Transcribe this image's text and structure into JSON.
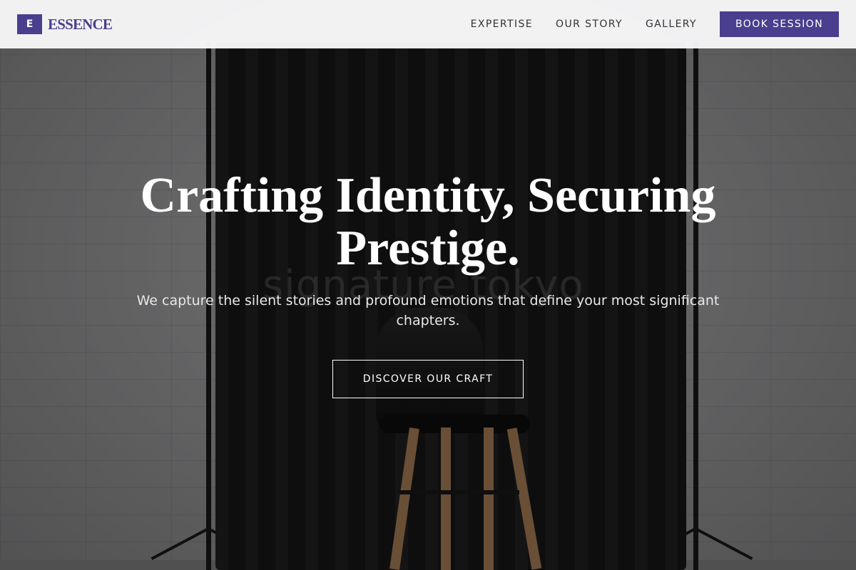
{
  "brand": {
    "mark": "E",
    "name": "ESSENCE",
    "accent_color": "#4a3e8e"
  },
  "nav": {
    "items": [
      {
        "label": "EXPERTISE"
      },
      {
        "label": "OUR STORY"
      },
      {
        "label": "GALLERY"
      }
    ],
    "cta_label": "BOOK SESSION"
  },
  "hero": {
    "headline": "Crafting Identity, Securing Prestige.",
    "subheadline": "We capture the silent stories and profound emotions that define your most significant chapters.",
    "cta_label": "DISCOVER OUR CRAFT",
    "background_text": "signature tokyo"
  }
}
